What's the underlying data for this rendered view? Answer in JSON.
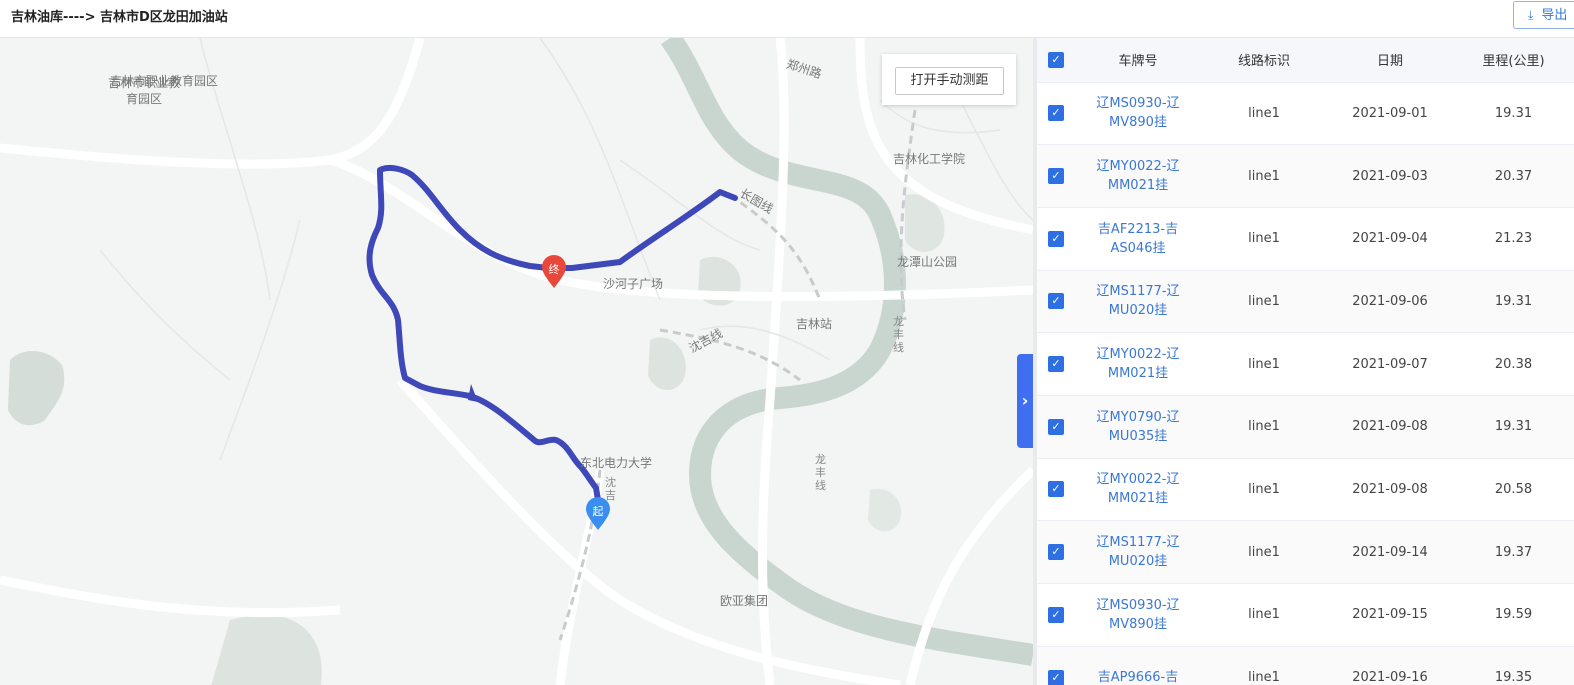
{
  "header": {
    "route_title": "吉林油库----> 吉林市D区龙田加油站",
    "export_label": "导出",
    "export_icon": "download-icon"
  },
  "map": {
    "measure_button": "打开手动测距",
    "collapse_icon": "chevron-right-icon",
    "start_marker": "起",
    "end_marker": "终",
    "labels": {
      "school": "吉林市职业教育园区",
      "zhengzhou_road": "郑州路",
      "chem_college": "吉林化工学院",
      "changtu_line": "长图线",
      "longtan_park": "龙潭山公园",
      "shahezi": "沙河子广场",
      "longfeng_line": "龙丰线",
      "jilin_station": "吉林站",
      "shenji_line": "沈吉线",
      "ne_power_univ": "东北电力大学",
      "shen_ji": "沈吉",
      "longfeng_line2": "龙丰线",
      "ouya": "欧亚集团"
    },
    "route_color": "#3f48b8"
  },
  "table": {
    "columns": [
      "车牌号",
      "线路标识",
      "日期",
      "里程(公里)"
    ],
    "rows": [
      {
        "plate": "辽MS0930-辽MV890挂",
        "line": "line1",
        "date": "2021-09-01",
        "km": "19.31"
      },
      {
        "plate": "辽MY0022-辽MM021挂",
        "line": "line1",
        "date": "2021-09-03",
        "km": "20.37"
      },
      {
        "plate": "吉AF2213-吉AS046挂",
        "line": "line1",
        "date": "2021-09-04",
        "km": "21.23"
      },
      {
        "plate": "辽MS1177-辽MU020挂",
        "line": "line1",
        "date": "2021-09-06",
        "km": "19.31"
      },
      {
        "plate": "辽MY0022-辽MM021挂",
        "line": "line1",
        "date": "2021-09-07",
        "km": "20.38"
      },
      {
        "plate": "辽MY0790-辽MU035挂",
        "line": "line1",
        "date": "2021-09-08",
        "km": "19.31"
      },
      {
        "plate": "辽MY0022-辽MM021挂",
        "line": "line1",
        "date": "2021-09-08",
        "km": "20.58"
      },
      {
        "plate": "辽MS1177-辽MU020挂",
        "line": "line1",
        "date": "2021-09-14",
        "km": "19.37"
      },
      {
        "plate": "辽MS0930-辽MV890挂",
        "line": "line1",
        "date": "2021-09-15",
        "km": "19.59"
      },
      {
        "plate": "吉AP9666-吉",
        "line": "line1",
        "date": "2021-09-16",
        "km": "19.35"
      }
    ]
  },
  "checkbox_icon": "checkmark-icon"
}
